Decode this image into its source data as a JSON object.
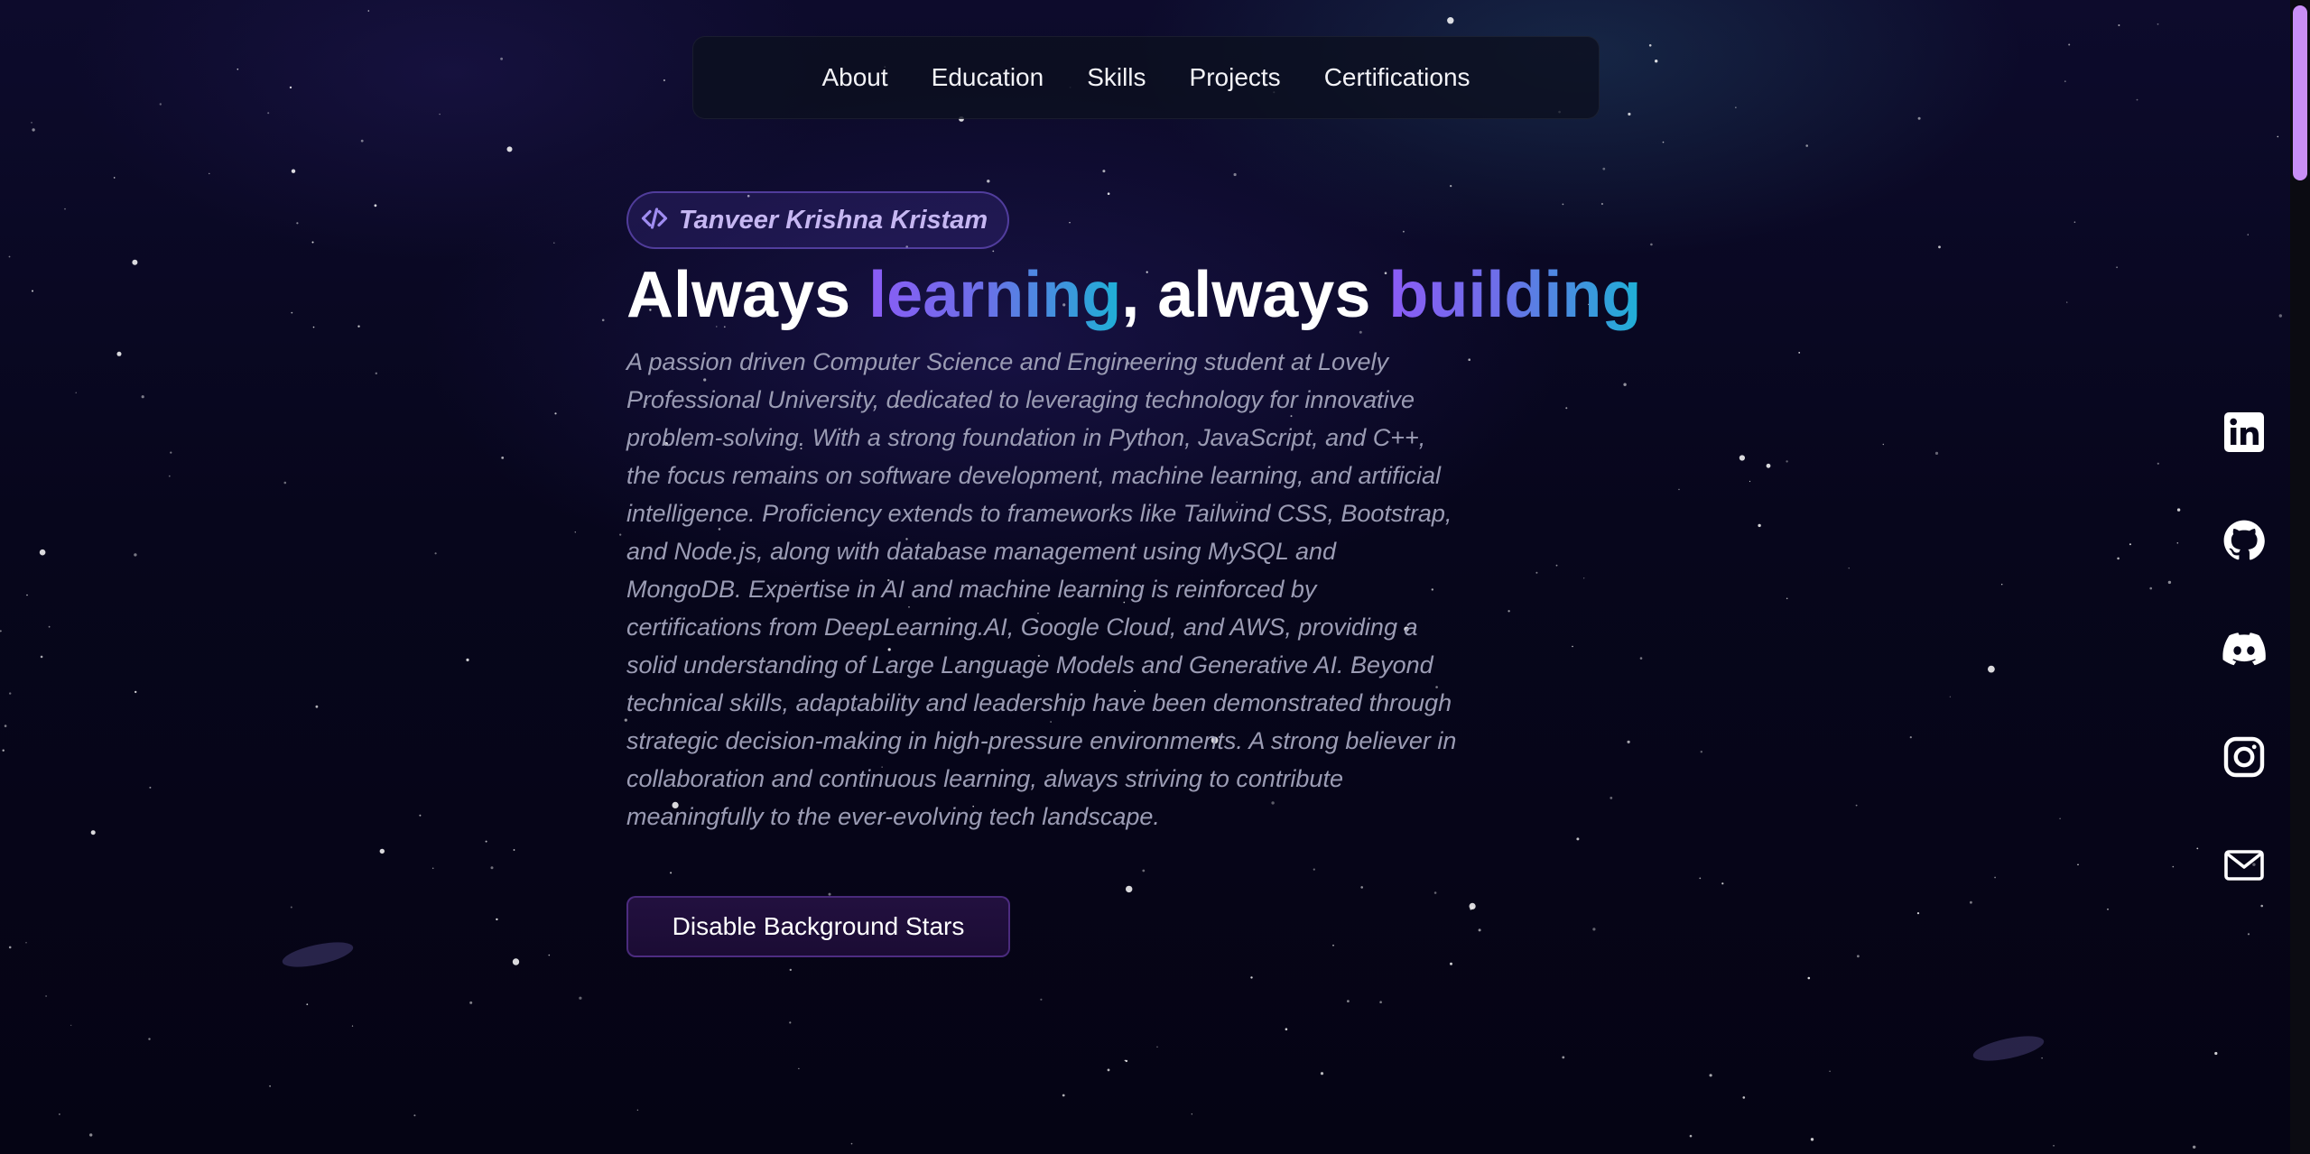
{
  "nav": {
    "links": [
      "About",
      "Education",
      "Skills",
      "Projects",
      "Certifications"
    ]
  },
  "hero": {
    "badge_icon": "code-icon",
    "badge_name": "Tanveer Krishna Kristam",
    "headline": {
      "part1": "Always ",
      "word1": "learning",
      "part2": ", always ",
      "word2": "building"
    },
    "bio": "A passion driven Computer Science and Engineering student at Lovely Professional University, dedicated to leveraging technology for innovative problem-solving. With a strong foundation in Python, JavaScript, and C++, the focus remains on software development, machine learning, and artificial intelligence. Proficiency extends to frameworks like Tailwind CSS, Bootstrap, and Node.js, along with database management using MySQL and MongoDB. Expertise in AI and machine learning is reinforced by certifications from DeepLearning.AI, Google Cloud, and AWS, providing a solid understanding of Large Language Models and Generative AI. Beyond technical skills, adaptability and leadership have been demonstrated through strategic decision-making in high-pressure environments. A strong believer in collaboration and continuous learning, always striving to contribute meaningfully to the ever-evolving tech landscape.",
    "cta_label": "Disable Background Stars"
  },
  "social": [
    "linkedin-icon",
    "github-icon",
    "discord-icon",
    "instagram-icon",
    "mail-icon"
  ],
  "colors": {
    "accent_purple": "#8b5cf6",
    "accent_cyan": "#1eb0d6",
    "background": "#06041a",
    "scroll_thumb": "#c98ff5"
  }
}
